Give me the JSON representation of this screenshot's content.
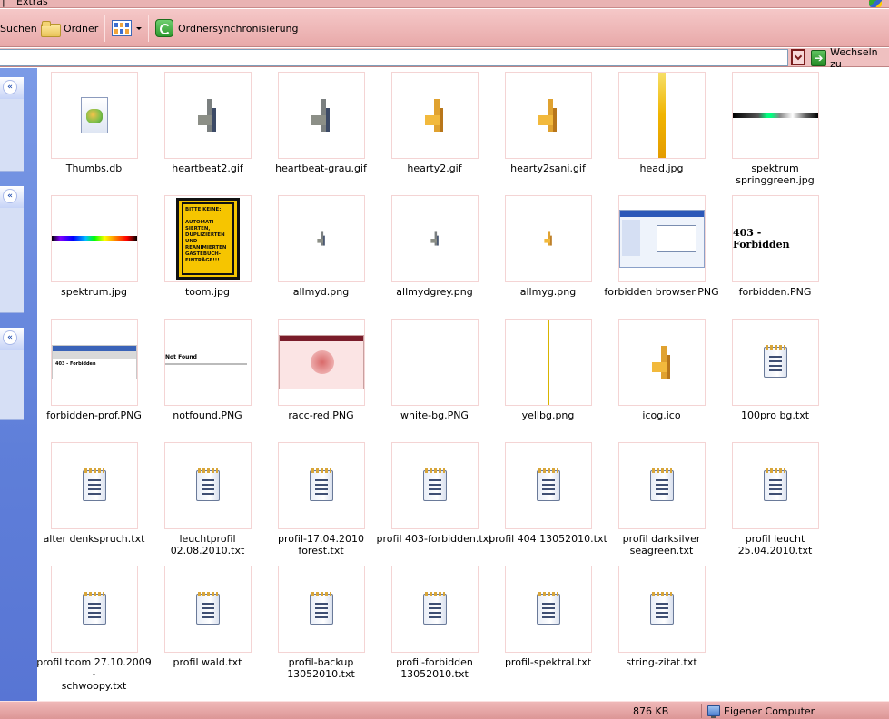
{
  "menubar": {
    "sep": "|",
    "extras": "Extras"
  },
  "toolbar": {
    "search_label": "Suchen",
    "folders_label": "Ordner",
    "sync_label": "Ordnersynchronisierung"
  },
  "addressbar": {
    "value": "",
    "go_label": "Wechseln zu"
  },
  "taskpane": {
    "collapse_glyph": "«"
  },
  "files": [
    {
      "name": "Thumbs.db",
      "icon": "thumbs-db-icon"
    },
    {
      "name": "heartbeat2.gif",
      "icon": "heartbeat-gray-icon"
    },
    {
      "name": "heartbeat-grau.gif",
      "icon": "heartbeat-gray-icon"
    },
    {
      "name": "hearty2.gif",
      "icon": "heartbeat-orange-icon"
    },
    {
      "name": "hearty2sani.gif",
      "icon": "heartbeat-orange-icon"
    },
    {
      "name": "head.jpg",
      "icon": "gradient-bar-thumbnail"
    },
    {
      "name": "spektrum\nspringgreen.jpg",
      "icon": "spectrum-springgreen-thumbnail"
    },
    {
      "name": "spektrum.jpg",
      "icon": "spectrum-thumbnail"
    },
    {
      "name": "toom.jpg",
      "icon": "yellow-sign-thumbnail",
      "sign_text": "BITTE KEINE:\n\nAUTOMATI-\nSIERTEN,\nDUPLIZIERTEN\nUND\nREANIMIERTEN\nGÄSTEBUCH-\nEINTRÄGE!!!"
    },
    {
      "name": "allmyd.png",
      "icon": "heartbeat-gray-small-icon"
    },
    {
      "name": "allmydgrey.png",
      "icon": "heartbeat-gray-small-icon"
    },
    {
      "name": "allmyg.png",
      "icon": "heartbeat-orange-small-icon"
    },
    {
      "name": "forbidden browser.PNG",
      "icon": "screenshot-thumbnail"
    },
    {
      "name": "forbidden.PNG",
      "icon": "forbidden-text-thumbnail",
      "thumb_text": "403 - Forbidden"
    },
    {
      "name": "forbidden-prof.PNG",
      "icon": "profile-screenshot-thumbnail",
      "thumb_text": "403 - Forbidden"
    },
    {
      "name": "notfound.PNG",
      "icon": "notfound-thumbnail",
      "thumb_text": "Not Found"
    },
    {
      "name": "racc-red.PNG",
      "icon": "red-page-thumbnail"
    },
    {
      "name": "white-bg.PNG",
      "icon": "blank-thumbnail"
    },
    {
      "name": "yellbg.png",
      "icon": "yellow-line-thumbnail"
    },
    {
      "name": "icog.ico",
      "icon": "heartbeat-orange-icon"
    },
    {
      "name": "100pro bg.txt",
      "icon": "notepad-icon"
    },
    {
      "name": "alter denkspruch.txt",
      "icon": "notepad-icon"
    },
    {
      "name": "leuchtprofil\n02.08.2010.txt",
      "icon": "notepad-icon"
    },
    {
      "name": "profil-17.04.2010\nforest.txt",
      "icon": "notepad-icon"
    },
    {
      "name": "profil 403-forbidden.txt",
      "icon": "notepad-icon"
    },
    {
      "name": "profil 404 13052010.txt",
      "icon": "notepad-icon"
    },
    {
      "name": "profil darksilver\nseagreen.txt",
      "icon": "notepad-icon"
    },
    {
      "name": "profil leucht\n25.04.2010.txt",
      "icon": "notepad-icon"
    },
    {
      "name": "profil toom 27.10.2009 -\nschwoopy.txt",
      "icon": "notepad-icon"
    },
    {
      "name": "profil wald.txt",
      "icon": "notepad-icon"
    },
    {
      "name": "profil-backup\n13052010.txt",
      "icon": "notepad-icon"
    },
    {
      "name": "profil-forbidden\n13052010.txt",
      "icon": "notepad-icon"
    },
    {
      "name": "profil-spektral.txt",
      "icon": "notepad-icon"
    },
    {
      "name": "string-zitat.txt",
      "icon": "notepad-icon"
    }
  ],
  "statusbar": {
    "size": "876 KB",
    "location": "Eigener Computer"
  },
  "colors": {
    "chrome": "#e8a9a9",
    "taskpane": "#6a89dd",
    "accent_green": "#2e9a2e"
  }
}
